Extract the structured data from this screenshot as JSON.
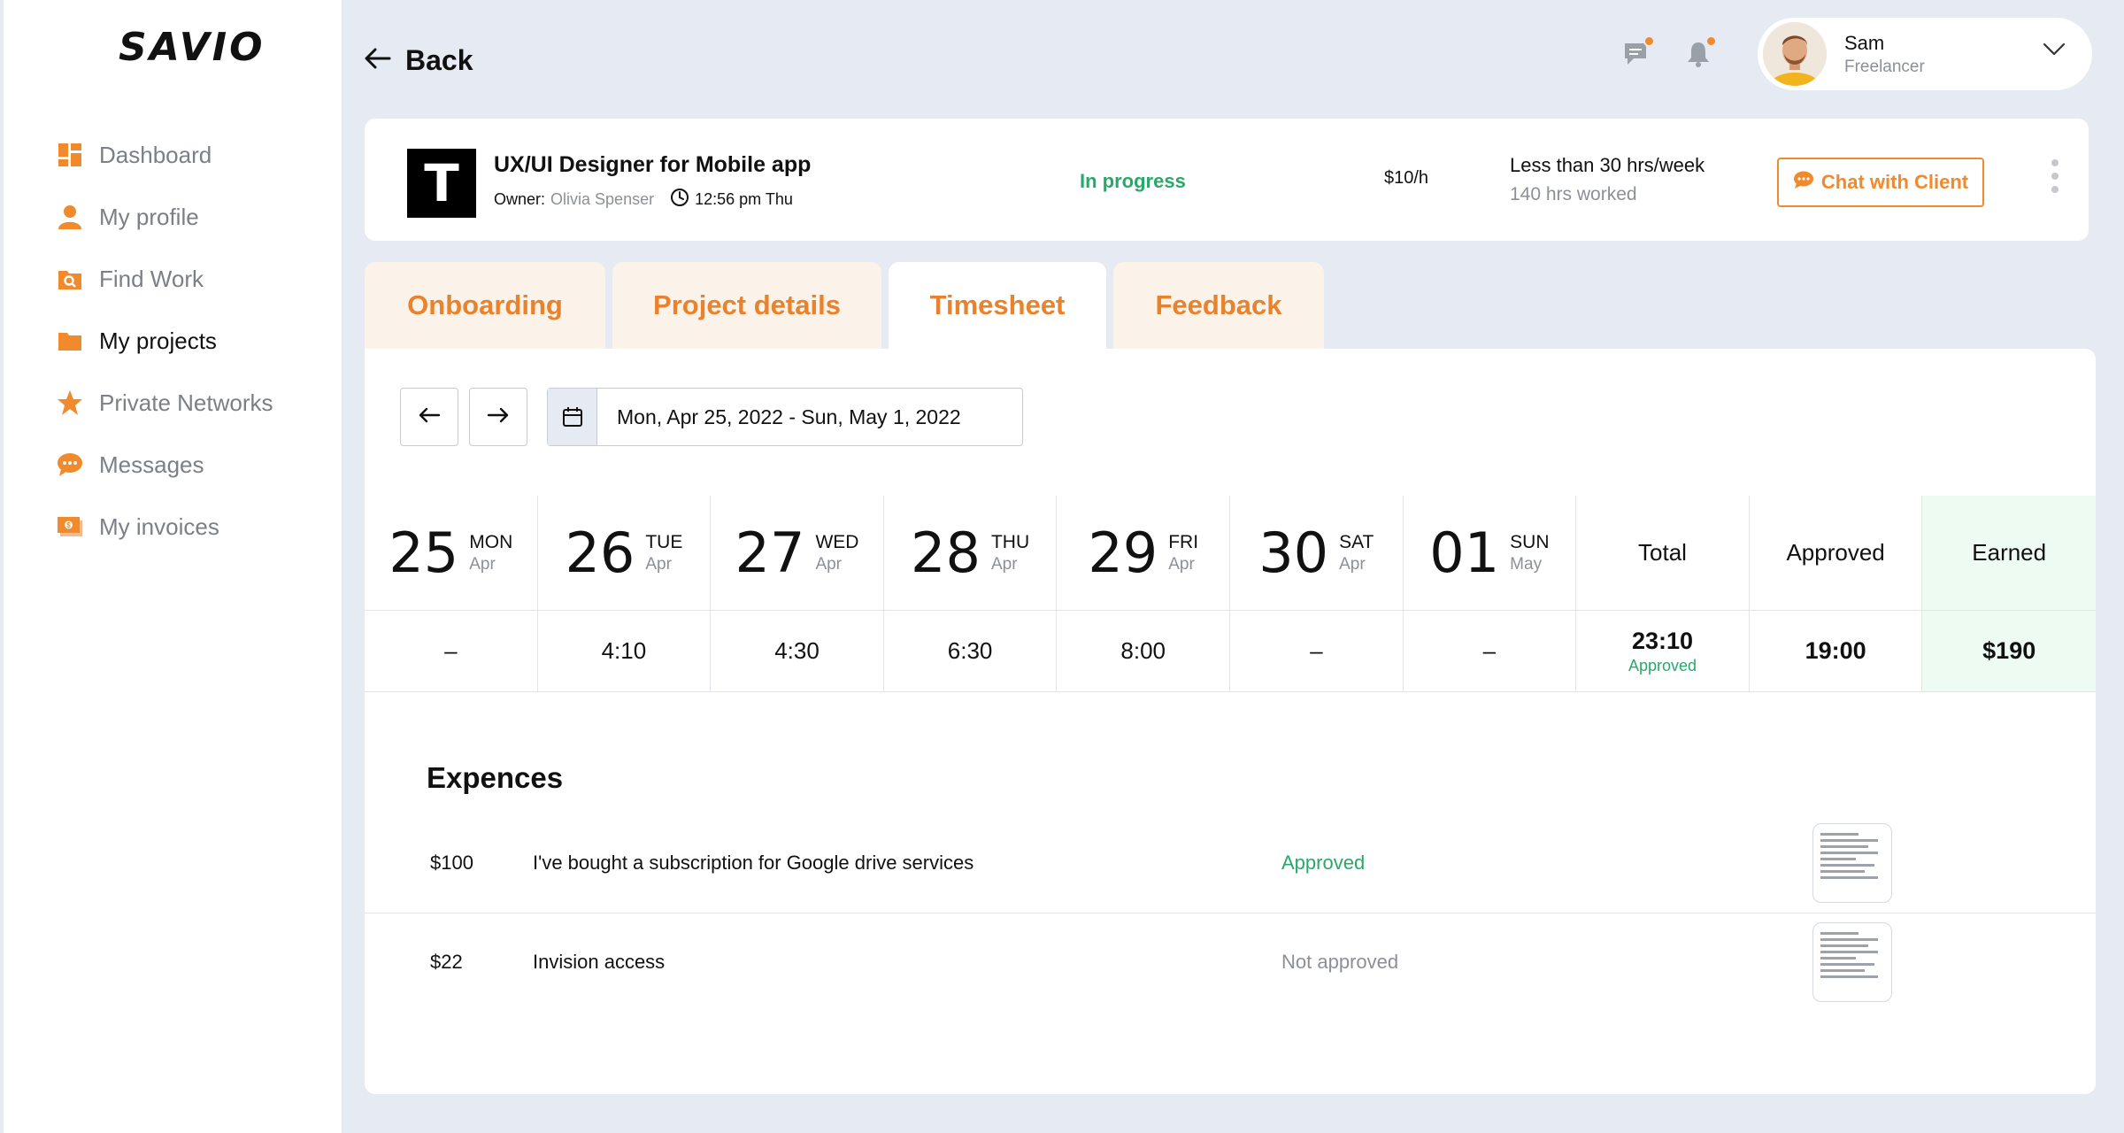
{
  "app": {
    "logo": "SAVIO"
  },
  "sidebar": {
    "items": [
      {
        "label": "Dashboard",
        "icon": "dashboard-icon"
      },
      {
        "label": "My profile",
        "icon": "user-icon"
      },
      {
        "label": "Find Work",
        "icon": "find-work-icon"
      },
      {
        "label": "My projects",
        "icon": "folder-icon",
        "active": true
      },
      {
        "label": "Private Networks",
        "icon": "star-icon"
      },
      {
        "label": "Messages",
        "icon": "chat-icon"
      },
      {
        "label": "My invoices",
        "icon": "invoice-icon"
      }
    ]
  },
  "header": {
    "back_label": "Back",
    "user": {
      "name": "Sam",
      "role": "Freelancer"
    }
  },
  "project": {
    "logo_letter": "T",
    "title": "UX/UI Designer for Mobile app",
    "owner_label": "Owner:",
    "owner_name": "Olivia Spenser",
    "time": "12:56 pm Thu",
    "status": "In progress",
    "rate": "$10/h",
    "hours_limit": "Less than 30 hrs/week",
    "hours_worked": "140 hrs worked",
    "chat_label": "Chat with Client"
  },
  "tabs": [
    {
      "label": "Onboarding"
    },
    {
      "label": "Project details"
    },
    {
      "label": "Timesheet",
      "active": true
    },
    {
      "label": "Feedback"
    }
  ],
  "timesheet": {
    "date_range": "Mon, Apr 25, 2022 - Sun, May 1, 2022",
    "days": [
      {
        "num": "25",
        "name": "MON",
        "month": "Apr",
        "value": "–"
      },
      {
        "num": "26",
        "name": "TUE",
        "month": "Apr",
        "value": "4:10"
      },
      {
        "num": "27",
        "name": "WED",
        "month": "Apr",
        "value": "4:30"
      },
      {
        "num": "28",
        "name": "THU",
        "month": "Apr",
        "value": "6:30"
      },
      {
        "num": "29",
        "name": "FRI",
        "month": "Apr",
        "value": "8:00"
      },
      {
        "num": "30",
        "name": "SAT",
        "month": "Apr",
        "value": "–"
      },
      {
        "num": "01",
        "name": "SUN",
        "month": "May",
        "value": "–"
      }
    ],
    "total": {
      "label": "Total",
      "value": "23:10",
      "sub": "Approved"
    },
    "approved": {
      "label": "Approved",
      "value": "19:00"
    },
    "earned": {
      "label": "Earned",
      "value": "$190"
    }
  },
  "expenses": {
    "title": "Expences",
    "items": [
      {
        "amount": "$100",
        "description": "I've bought a subscription for Google drive services",
        "status": "Approved",
        "status_color": "#2aa86a"
      },
      {
        "amount": "$22",
        "description": "Invision access",
        "status": "Not approved",
        "status_color": "#8c9096"
      }
    ]
  },
  "colors": {
    "accent": "#f08a2c",
    "success": "#2aa86a",
    "muted": "#8c9096"
  }
}
